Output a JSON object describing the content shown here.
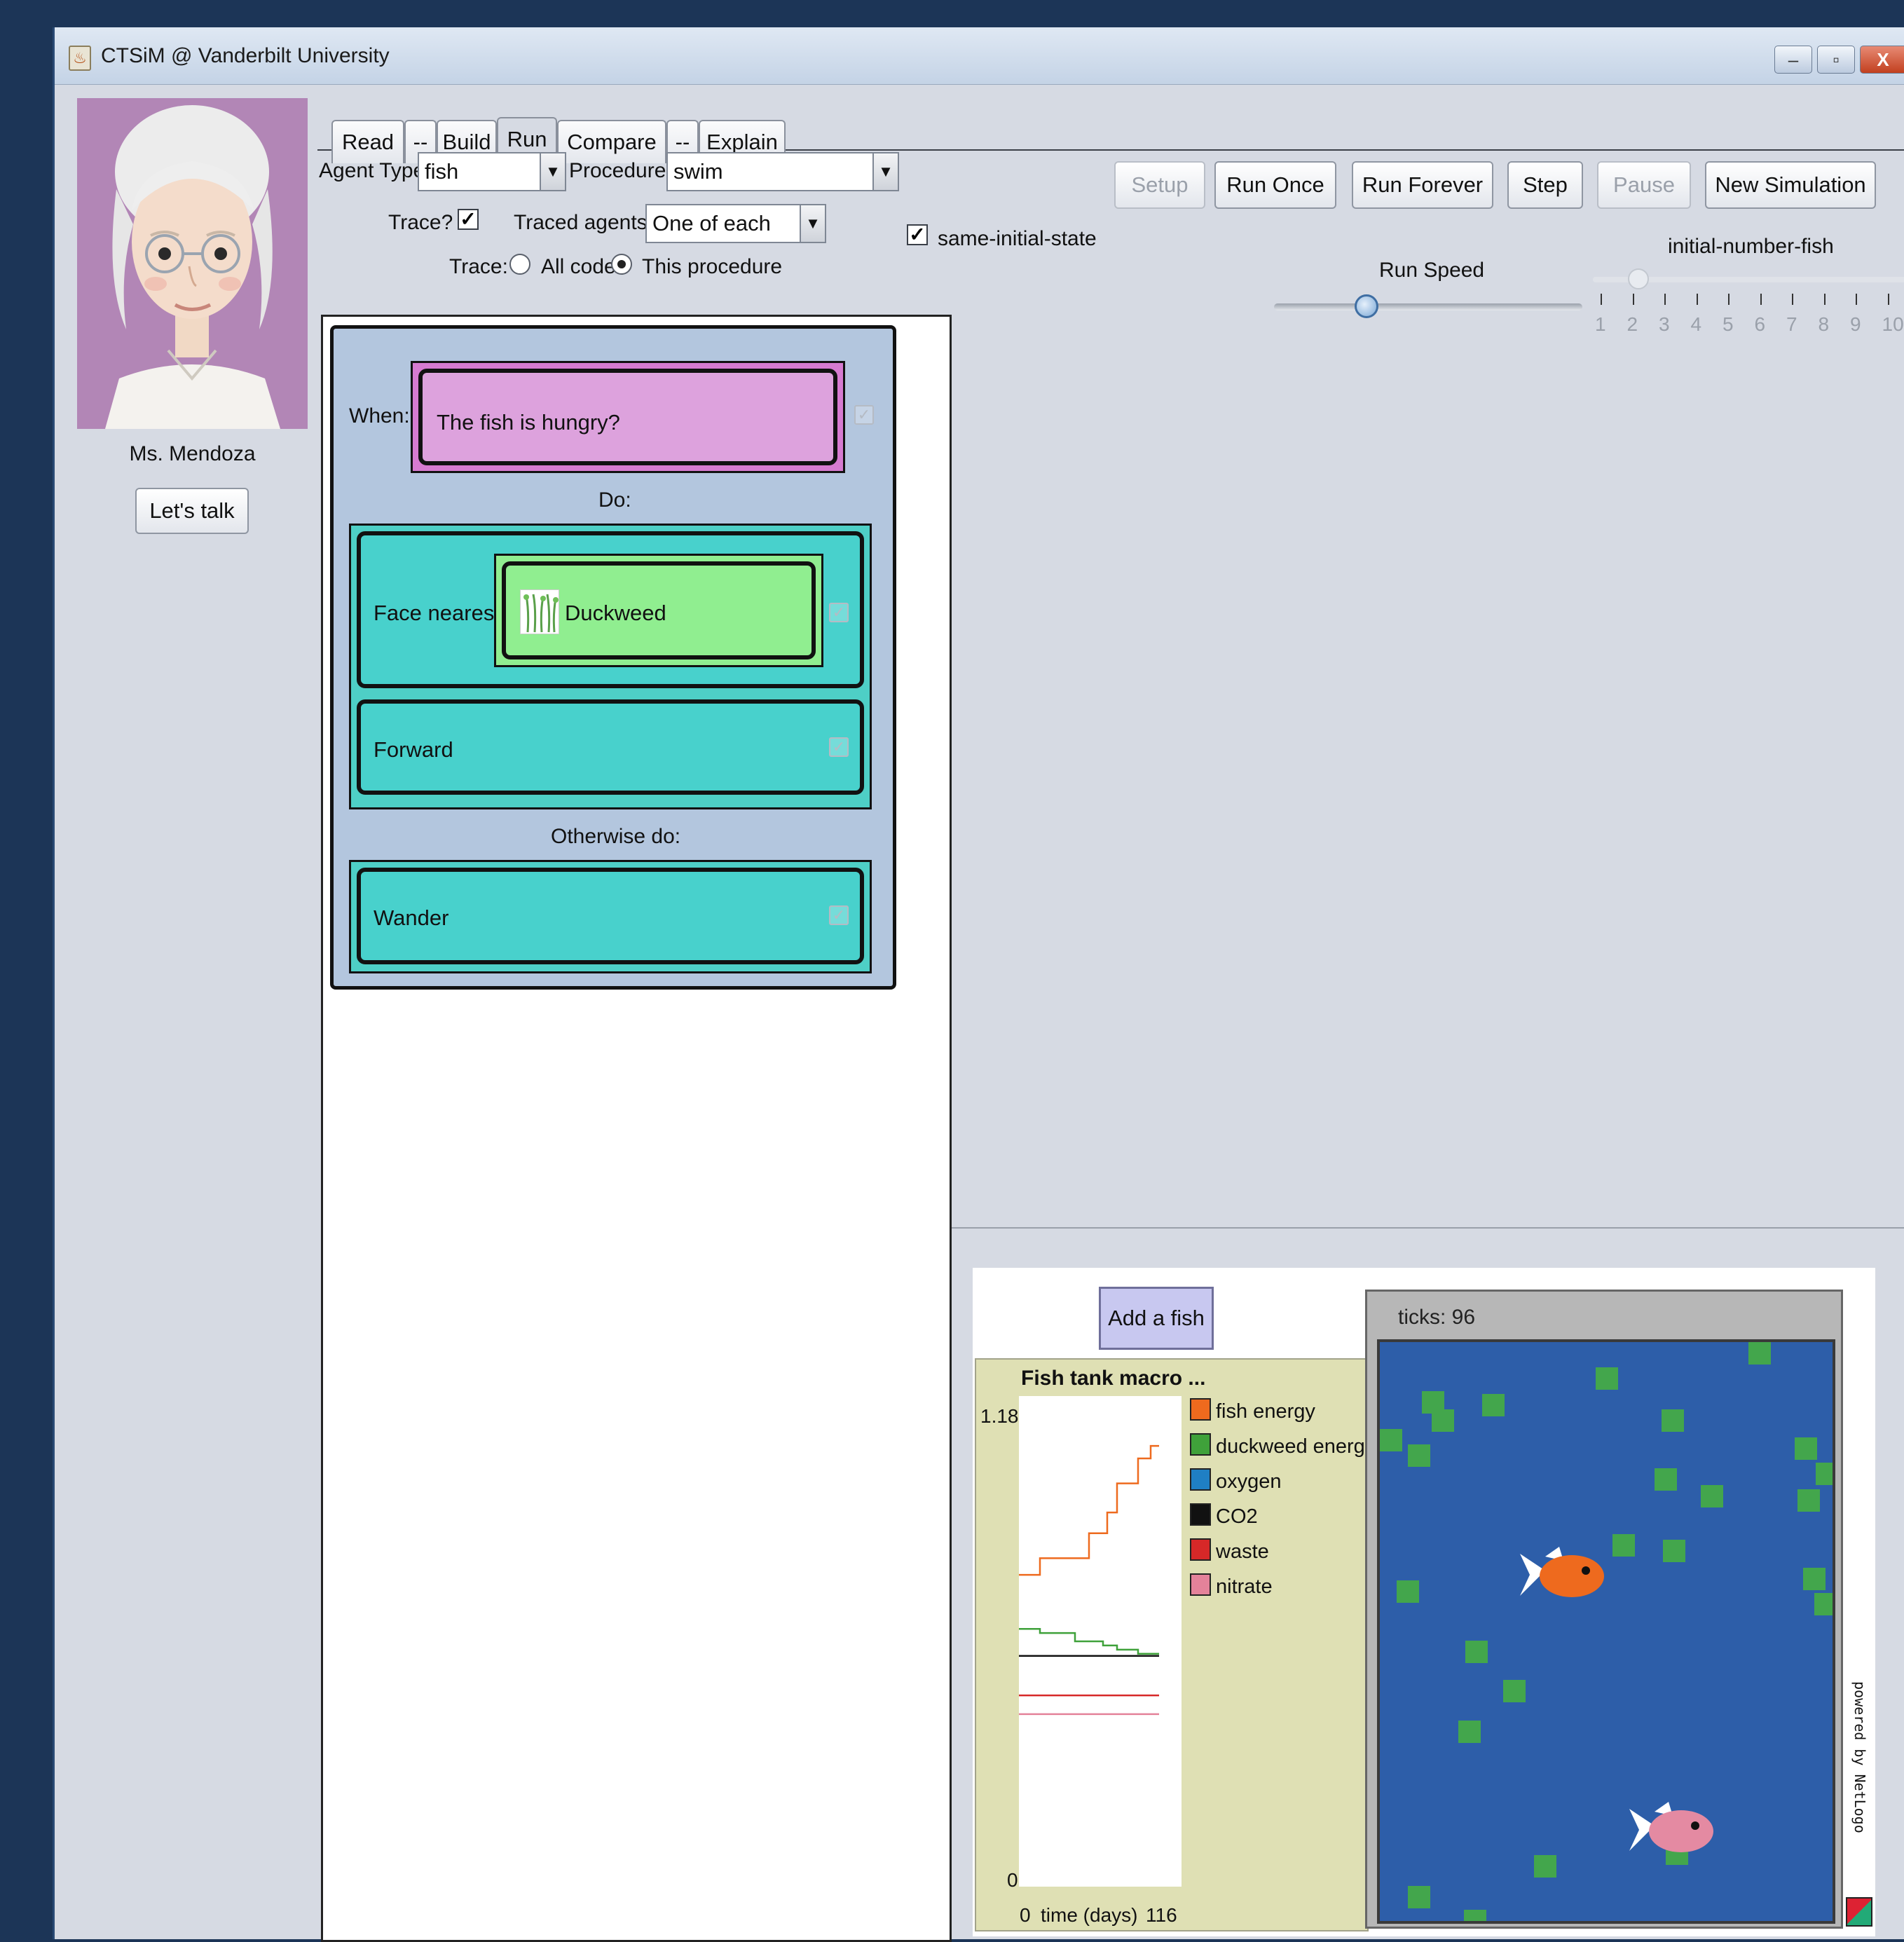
{
  "window": {
    "title": "CTSiM @ Vanderbilt University",
    "controls": [
      "–",
      "▫",
      "X"
    ]
  },
  "mentor": {
    "name": "Ms. Mendoza",
    "talk_button": "Let's talk"
  },
  "tabs": [
    "Read",
    "--",
    "Build",
    "Run",
    "Compare",
    "--",
    "Explain"
  ],
  "active_tab": "Run",
  "controls": {
    "agent_type_label": "Agent Type:",
    "agent_type_value": "fish",
    "procedure_label": "Procedure:",
    "procedure_value": "swim",
    "trace_label": "Trace?",
    "trace_checked": true,
    "traced_agents_label": "Traced agents:",
    "traced_agents_value": "One of each",
    "trace_mode_label": "Trace:",
    "trace_all_label": "All code",
    "trace_this_label": "This procedure",
    "trace_mode_selected": "This procedure"
  },
  "code": {
    "when_label": "When:",
    "condition": "The fish is hungry?",
    "do_label": "Do:",
    "face_nearest_label": "Face nearest",
    "face_nearest_target": "Duckweed",
    "forward_label": "Forward",
    "otherwise_label": "Otherwise do:",
    "wander_label": "Wander",
    "check_glyph": "✓"
  },
  "sim_buttons": [
    {
      "label": "Setup",
      "enabled": false
    },
    {
      "label": "Run Once",
      "enabled": true
    },
    {
      "label": "Run Forever",
      "enabled": true
    },
    {
      "label": "Step",
      "enabled": true
    },
    {
      "label": "Pause",
      "enabled": false
    },
    {
      "label": "New Simulation",
      "enabled": true
    }
  ],
  "same_initial_state": {
    "label": "same-initial-state",
    "checked": true
  },
  "run_speed": {
    "label": "Run Speed",
    "value_fraction": 0.3
  },
  "initial_number_fish": {
    "label": "initial-number-fish",
    "ticks": [
      "1",
      "2",
      "3",
      "4",
      "5",
      "6",
      "7",
      "8",
      "9",
      "10"
    ],
    "value": 2
  },
  "netlogo": {
    "add_fish_label": "Add a fish",
    "ticks_label": "ticks: 96",
    "powered_by": "powered by NetLogo",
    "world_color": "#2d5ea9",
    "duckweed_color": "#43a64c"
  },
  "chart_data": {
    "type": "line",
    "title": "Fish tank macro ...",
    "xlabel": "time (days)",
    "ylabel": "",
    "xlim": [
      0,
      116
    ],
    "ylim": [
      0,
      1.18
    ],
    "x_tick_labels": [
      "0",
      "116"
    ],
    "y_tick_labels": [
      "0",
      "1.18"
    ],
    "legend_position": "right",
    "series": [
      {
        "name": "fish energy",
        "color": "#ee6a1e",
        "points": [
          [
            0,
            0.75
          ],
          [
            15,
            0.75
          ],
          [
            15,
            0.79
          ],
          [
            50,
            0.79
          ],
          [
            50,
            0.85
          ],
          [
            63,
            0.85
          ],
          [
            63,
            0.9
          ],
          [
            70,
            0.9
          ],
          [
            70,
            0.97
          ],
          [
            85,
            0.97
          ],
          [
            85,
            1.03
          ],
          [
            94,
            1.03
          ],
          [
            94,
            1.06
          ],
          [
            100,
            1.06
          ]
        ]
      },
      {
        "name": "duckweed energy",
        "color": "#3fa13a",
        "points": [
          [
            0,
            0.62
          ],
          [
            15,
            0.62
          ],
          [
            15,
            0.61
          ],
          [
            40,
            0.61
          ],
          [
            40,
            0.59
          ],
          [
            60,
            0.59
          ],
          [
            60,
            0.58
          ],
          [
            70,
            0.58
          ],
          [
            70,
            0.57
          ],
          [
            85,
            0.57
          ],
          [
            85,
            0.56
          ],
          [
            100,
            0.56
          ]
        ]
      },
      {
        "name": "oxygen",
        "color": "#1f7fc4",
        "points": []
      },
      {
        "name": "CO2",
        "color": "#111111",
        "points": [
          [
            0,
            0.555
          ],
          [
            100,
            0.555
          ]
        ]
      },
      {
        "name": "waste",
        "color": "#d62828",
        "points": [
          [
            0,
            0.46
          ],
          [
            100,
            0.46
          ]
        ]
      },
      {
        "name": "nitrate",
        "color": "#e4829a",
        "points": [
          [
            0,
            0.415
          ],
          [
            100,
            0.415
          ]
        ]
      }
    ]
  }
}
